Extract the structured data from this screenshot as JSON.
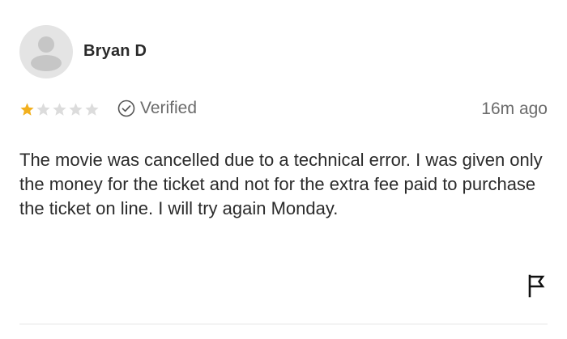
{
  "review": {
    "reviewer_name": "Bryan D",
    "rating": 1,
    "rating_max": 5,
    "verified_label": "Verified",
    "timestamp": "16m ago",
    "body": "The movie was cancelled due to a technical error. I was given only the money for the ticket and not for the extra fee paid to purchase the ticket on line. I will try again Monday."
  },
  "icons": {
    "avatar": "default-user-avatar-icon",
    "verified": "check-circle-icon",
    "flag": "flag-icon",
    "star": "star-icon"
  },
  "colors": {
    "star_filled": "#f2b01e",
    "star_empty": "#dcdcdc",
    "avatar_bg": "#e4e4e4",
    "avatar_figure": "#c6c6c6",
    "muted_text": "#6b6b6b"
  }
}
